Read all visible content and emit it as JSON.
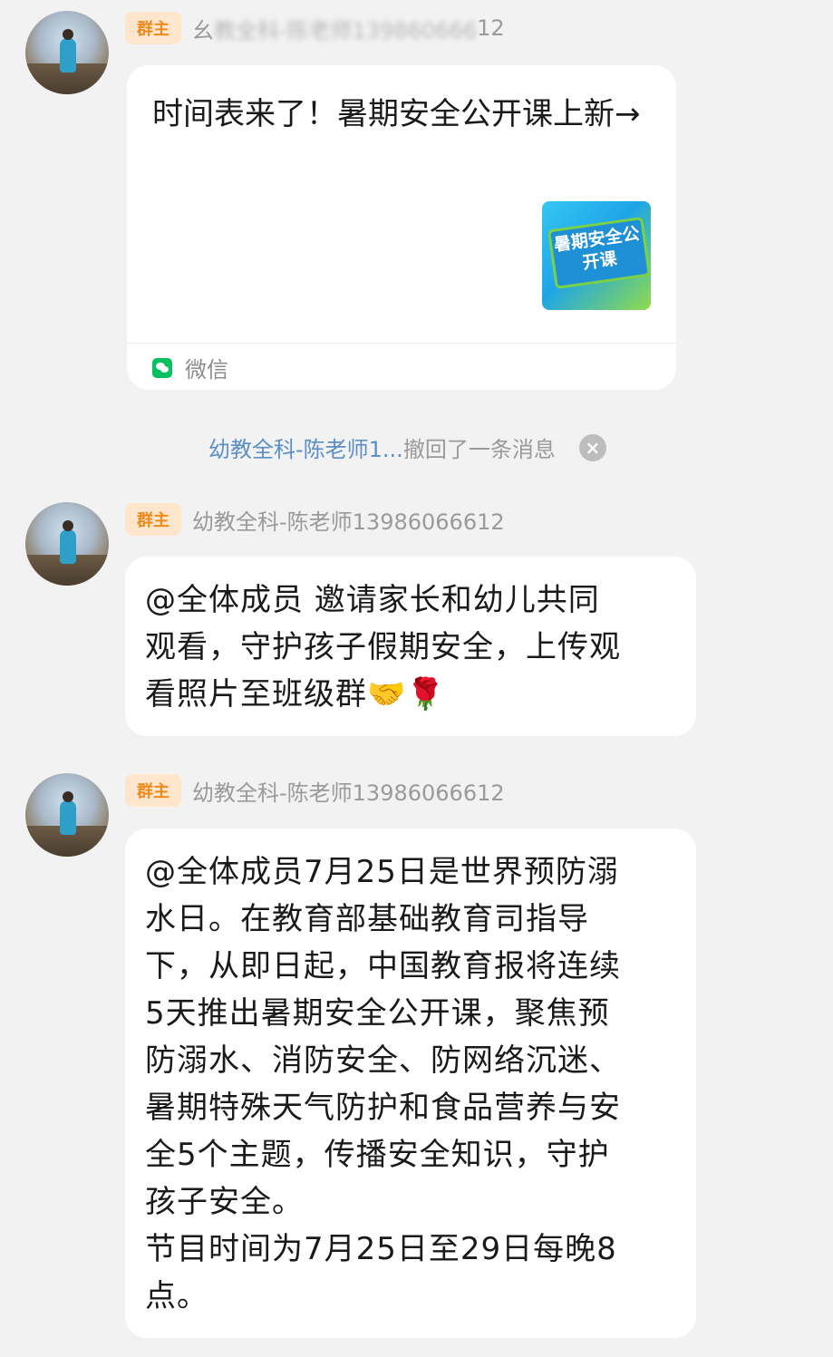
{
  "messages": [
    {
      "badge": "群主",
      "sender_prefix": "幺",
      "sender_masked": "教全科-陈老师139860666",
      "sender_suffix": "12",
      "card": {
        "title": "时间表来了！暑期安全公开课上新→",
        "thumbnail_text": "暑期安全公开课",
        "source": "微信"
      }
    },
    {
      "badge": "群主",
      "sender": "幼教全科-陈老师13986066612",
      "text": "@全体成员 邀请家长和幼儿共同\n观看，守护孩子假期安全，上传观\n看照片至班级群🤝🌹"
    },
    {
      "badge": "群主",
      "sender": "幼教全科-陈老师13986066612",
      "text": "@全体成员7月25日是世界预防溺\n水日。在教育部基础教育司指导\n下，从即日起，中国教育报将连续\n5天推出暑期安全公开课，聚焦预\n防溺水、消防安全、防网络沉迷、\n暑期特殊天气防护和食品营养与安\n全5个主题，传播安全知识，守护\n孩子安全。\n节目时间为7月25日至29日每晚8\n点。"
    }
  ],
  "recall_notice": {
    "who": "幼教全科-陈老师1...",
    "what": "撤回了一条消息",
    "close": "×"
  },
  "colors": {
    "background": "#f2f2f2",
    "bubble": "#ffffff",
    "badge_bg": "#fde6cc",
    "badge_text": "#f08a1c",
    "link_blue": "#5b8fc5",
    "wechat_green": "#07c160"
  }
}
